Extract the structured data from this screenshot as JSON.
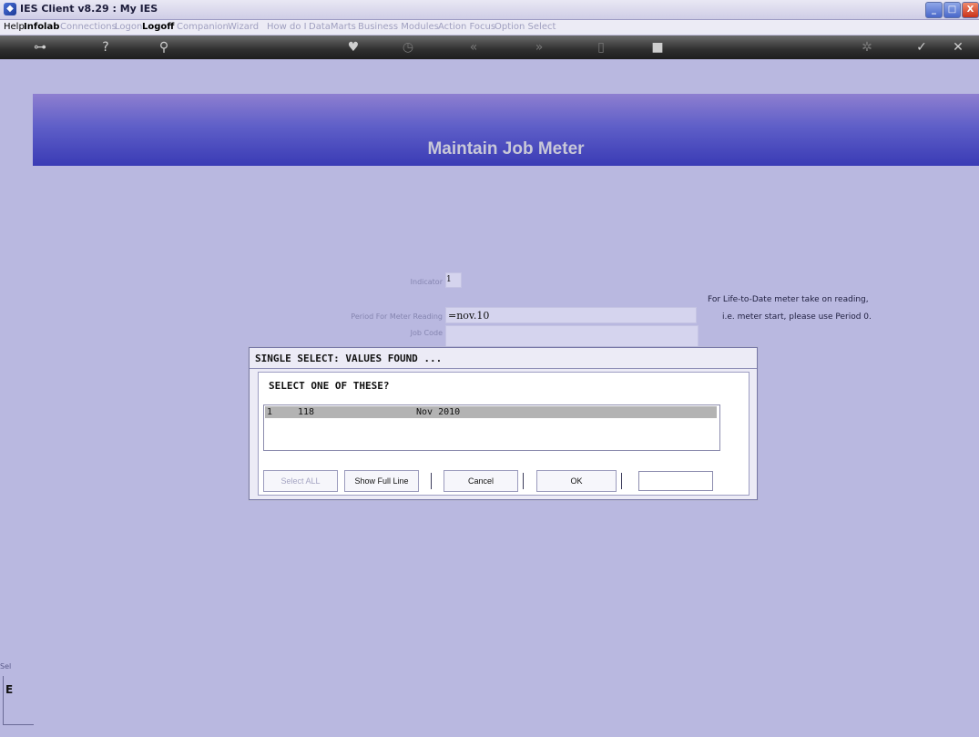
{
  "window": {
    "title": "IES Client v8.29 : My IES",
    "controls": {
      "minimize": "_",
      "maximize": "□",
      "close": "X"
    }
  },
  "menu": [
    {
      "label": "Help",
      "style": "active"
    },
    {
      "label": "Infolab",
      "style": "bold"
    },
    {
      "label": "Connections",
      "style": "dim"
    },
    {
      "label": "Logon",
      "style": "dim"
    },
    {
      "label": "Logoff",
      "style": "bold"
    },
    {
      "label": "Companion",
      "style": "dim"
    },
    {
      "label": "Wizard",
      "style": "dim"
    },
    {
      "label": "How do I",
      "style": "dim"
    },
    {
      "label": "DataMarts",
      "style": "dim"
    },
    {
      "label": "Business Modules",
      "style": "dim"
    },
    {
      "label": "Action Focus",
      "style": "dim"
    },
    {
      "label": "Option Select",
      "style": "dim"
    }
  ],
  "toolbar": {
    "icons": [
      "key-icon",
      "help-icon",
      "search-icon",
      "heart-icon",
      "clock-icon",
      "rewind-icon",
      "fast-forward-icon",
      "document-icon",
      "stop-icon",
      "settings-icon",
      "check-icon",
      "close-icon"
    ]
  },
  "header": {
    "title": "Maintain Job Meter"
  },
  "form": {
    "indicator_label": "Indicator",
    "indicator_value": "1",
    "period_label": "Period For Meter Reading",
    "period_value": "=nov.10",
    "jobcode_label": "Job Code",
    "jobcode_value": "",
    "note_line1": "For Life-to-Date meter take on reading,",
    "note_line2": "i.e. meter start, please use Period 0."
  },
  "dialog": {
    "title": "SINGLE SELECT: VALUES FOUND ...",
    "prompt": "SELECT ONE OF THESE?",
    "rows": [
      {
        "col1": "1",
        "col2": "118",
        "col3": "Nov 2010"
      }
    ],
    "buttons": {
      "select_all": "Select ALL",
      "show_full_line": "Show Full Line",
      "cancel": "Cancel",
      "ok": "OK"
    },
    "input_value": ""
  },
  "bottom_left": {
    "text1": "Sel",
    "text2": "E"
  }
}
